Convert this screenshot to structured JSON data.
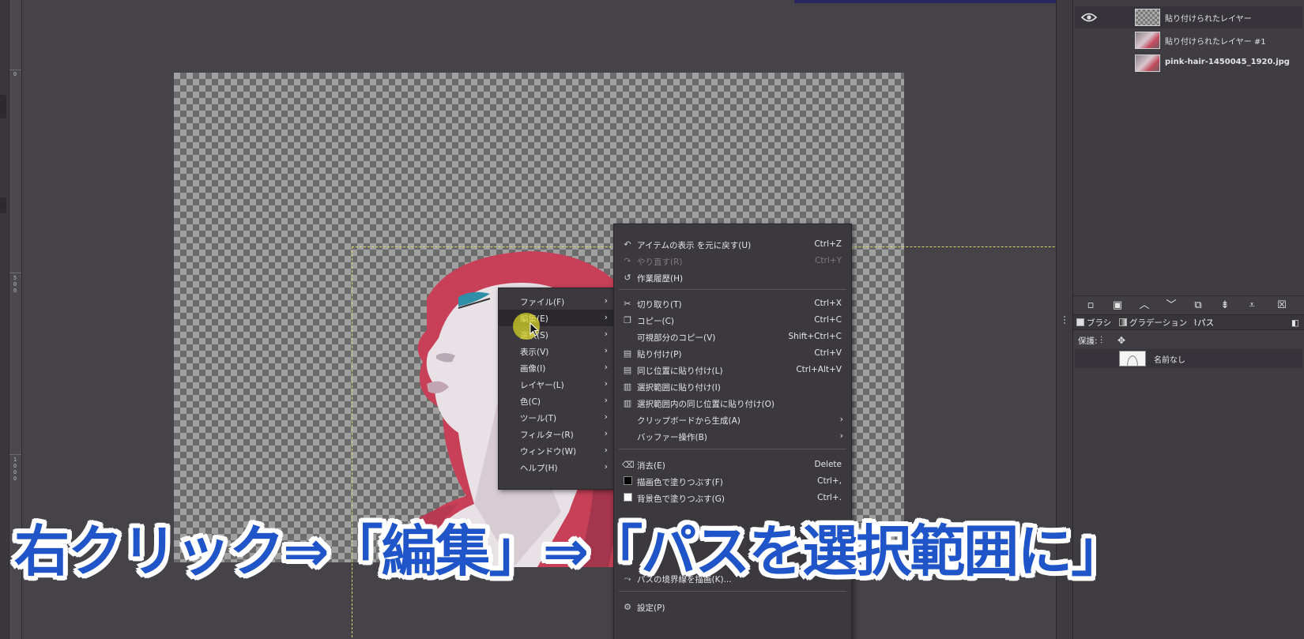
{
  "ruler": {
    "ticks": [
      "0",
      "5\n0\n0",
      "1\n0\n0\n0"
    ]
  },
  "layers": [
    {
      "name": "貼り付けられたレイヤー",
      "visible": true,
      "thumbnail": "checker"
    },
    {
      "name": "貼り付けられたレイヤー #1",
      "visible": false,
      "thumbnail": "photo"
    },
    {
      "name": "pink-hair-1450045_1920.jpg",
      "visible": false,
      "thumbnail": "photo"
    }
  ],
  "layer_buttons": [
    "new-layer-icon",
    "layer-group-icon",
    "raise-icon",
    "lower-icon",
    "duplicate-icon",
    "anchor-icon",
    "merge-icon",
    "delete-icon"
  ],
  "dock_tabs": {
    "brushes": "ブラシ",
    "gradients": "グラデーション",
    "paths": "パス"
  },
  "lock": {
    "label": "保護:"
  },
  "paths": [
    {
      "name": "名前なし"
    }
  ],
  "context_menu": [
    {
      "label": "ファイル(F)"
    },
    {
      "label": "編集(E)",
      "highlighted": true
    },
    {
      "label": "選択(S)"
    },
    {
      "label": "表示(V)"
    },
    {
      "label": "画像(I)"
    },
    {
      "label": "レイヤー(L)"
    },
    {
      "label": "色(C)"
    },
    {
      "label": "ツール(T)"
    },
    {
      "label": "フィルター(R)"
    },
    {
      "label": "ウィンドウ(W)"
    },
    {
      "label": "ヘルプ(H)"
    }
  ],
  "edit_menu": {
    "undo": {
      "label": "アイテムの表示 を元に戻す(U)",
      "shortcut": "Ctrl+Z"
    },
    "redo": {
      "label": "やり直す(R)",
      "shortcut": "Ctrl+Y"
    },
    "history": {
      "label": "作業履歴(H)"
    },
    "cut": {
      "label": "切り取り(T)",
      "shortcut": "Ctrl+X"
    },
    "copy": {
      "label": "コピー(C)",
      "shortcut": "Ctrl+C"
    },
    "copy_visible": {
      "label": "可視部分のコピー(V)",
      "shortcut": "Shift+Ctrl+C"
    },
    "paste": {
      "label": "貼り付け(P)",
      "shortcut": "Ctrl+V"
    },
    "paste_in_place": {
      "label": "同じ位置に貼り付け(L)",
      "shortcut": "Ctrl+Alt+V"
    },
    "paste_into": {
      "label": "選択範囲に貼り付け(I)"
    },
    "paste_into_in_place": {
      "label": "選択範囲内の同じ位置に貼り付け(O)"
    },
    "paste_as": {
      "label": "クリップボードから生成(A)"
    },
    "buffer": {
      "label": "バッファー操作(B)"
    },
    "clear": {
      "label": "消去(E)",
      "shortcut": "Delete"
    },
    "fill_fg": {
      "label": "描画色で塗りつぶす(F)",
      "shortcut": "Ctrl+,"
    },
    "fill_bg": {
      "label": "背景色で塗りつぶす(G)",
      "shortcut": "Ctrl+."
    },
    "stroke_path": {
      "label": "パスの境界線を描画(K)..."
    },
    "preferences": {
      "label": "設定(P)"
    }
  },
  "colors": {
    "fg_swatch": "#000000",
    "bg_swatch": "#ffffff",
    "caption": "#1f55c8",
    "highlight": "#d6d228"
  },
  "caption": "右クリック⇒「編集」⇒「パスを選択範囲に」"
}
